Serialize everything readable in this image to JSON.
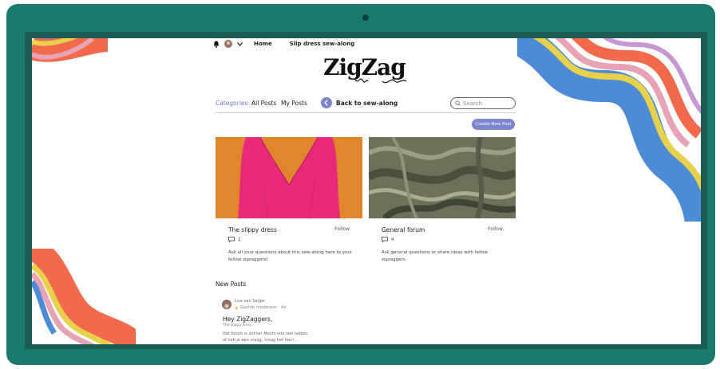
{
  "topbar": {
    "home_label": "Home",
    "sewalong_label": "Slip dress sew-along"
  },
  "logo": {
    "text": "ZigZag"
  },
  "nav": {
    "tabs": [
      {
        "label": "Categories",
        "active": true
      },
      {
        "label": "All Posts",
        "active": false
      },
      {
        "label": "My Posts",
        "active": false
      }
    ],
    "back_label": "Back to sew-along",
    "search_placeholder": "Search"
  },
  "create_post_label": "Create New Post",
  "categories": [
    {
      "title": "The slippy dress",
      "follow_label": "Follow",
      "comment_count": "1",
      "description": "Ask all your questions about this sew-along here to your fellow zigzaggers!"
    },
    {
      "title": "General forum",
      "follow_label": "Follow",
      "comment_count": "4",
      "description": "Ask general questions or share ideas with fellow zigzaggers."
    }
  ],
  "new_posts": {
    "heading": "New Posts",
    "items": [
      {
        "author": "Lisa van Salger",
        "meta": "Gestrip moderator · 4d",
        "title": "Hey ZigZaggers,",
        "category": "The slippy dress",
        "body": "Het forum is online! Mocht iets niet lukken of heb je een vraag, vraag het hier!..."
      }
    ]
  },
  "colors": {
    "bezel": "#1a7a6e",
    "accent": "#7c86cf",
    "dress_bg": "#e2862c",
    "dress": "#e8297a",
    "fabric": "#6b7257"
  }
}
